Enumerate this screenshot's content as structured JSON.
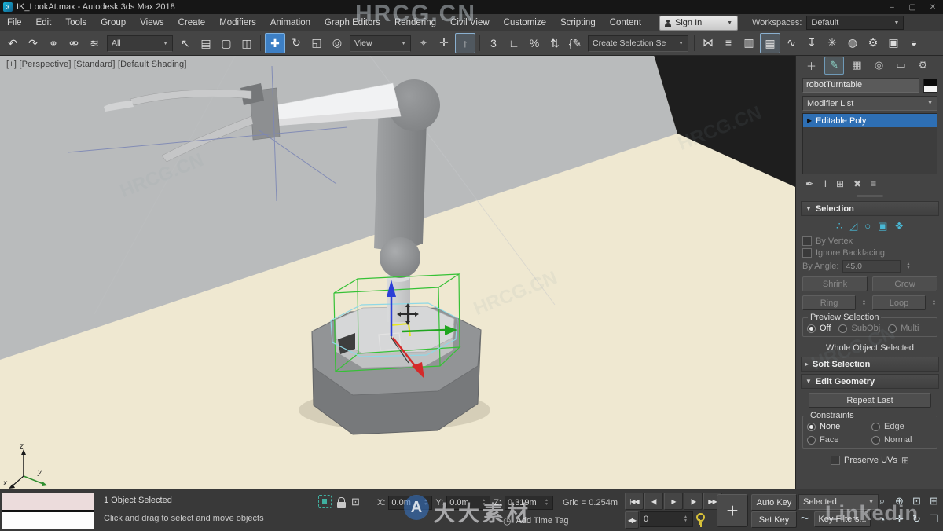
{
  "window": {
    "title": "IK_LookAt.max - Autodesk 3ds Max 2018",
    "logo": "3",
    "controls": [
      {
        "name": "minimize-button",
        "glyph": "–"
      },
      {
        "name": "maximize-button",
        "glyph": "▢"
      },
      {
        "name": "close-button",
        "glyph": "✕"
      }
    ]
  },
  "menu": {
    "items": [
      {
        "name": "menu-file",
        "label": "File"
      },
      {
        "name": "menu-edit",
        "label": "Edit"
      },
      {
        "name": "menu-tools",
        "label": "Tools"
      },
      {
        "name": "menu-group",
        "label": "Group"
      },
      {
        "name": "menu-views",
        "label": "Views"
      },
      {
        "name": "menu-create",
        "label": "Create"
      },
      {
        "name": "menu-modifiers",
        "label": "Modifiers"
      },
      {
        "name": "menu-animation",
        "label": "Animation"
      },
      {
        "name": "menu-graph-editors",
        "label": "Graph Editors"
      },
      {
        "name": "menu-rendering",
        "label": "Rendering"
      },
      {
        "name": "menu-civil-view",
        "label": "Civil View"
      },
      {
        "name": "menu-customize",
        "label": "Customize"
      },
      {
        "name": "menu-scripting",
        "label": "Scripting"
      },
      {
        "name": "menu-content",
        "label": "Content"
      }
    ],
    "sign_in": "Sign In",
    "workspaces_label": "Workspaces:",
    "workspace_value": "Default"
  },
  "toolbar": {
    "filter_value": "All",
    "coord_value": "View",
    "sets_value": "Create Selection Se",
    "group1": [
      {
        "name": "undo-button",
        "glyph": "↶"
      },
      {
        "name": "redo-button",
        "glyph": "↷"
      },
      {
        "name": "select-and-link-button",
        "glyph": "⚭"
      },
      {
        "name": "unlink-selection-button",
        "glyph": "⚮"
      },
      {
        "name": "bind-to-space-warp-button",
        "glyph": "≋"
      }
    ],
    "group2": [
      {
        "name": "select-object-button",
        "glyph": "↖"
      },
      {
        "name": "select-by-name-button",
        "glyph": "▤"
      },
      {
        "name": "rectangular-selection-region-button",
        "glyph": "▢"
      },
      {
        "name": "window-crossing-button",
        "glyph": "◫"
      }
    ],
    "group3": [
      {
        "name": "select-and-move-button",
        "glyph": "✚",
        "active": true
      },
      {
        "name": "select-and-rotate-button",
        "glyph": "↻"
      },
      {
        "name": "select-and-scale-button",
        "glyph": "◱"
      },
      {
        "name": "select-and-place-button",
        "glyph": "◎"
      }
    ],
    "group4": [
      {
        "name": "use-pivot-point-center-button",
        "glyph": "⌖"
      },
      {
        "name": "select-and-manipulate-button",
        "glyph": "✛"
      },
      {
        "name": "keyboard-shortcut-override-button",
        "glyph": "↑",
        "cls": "framed"
      }
    ],
    "group5": [
      {
        "name": "snap-toggle-3d-button",
        "glyph": "3"
      },
      {
        "name": "angle-snap-button",
        "glyph": "∟"
      },
      {
        "name": "percent-snap-button",
        "glyph": "%"
      },
      {
        "name": "spinner-snap-button",
        "glyph": "⇅"
      },
      {
        "name": "edit-named-selection-sets-button",
        "glyph": "{✎"
      }
    ],
    "group6": [
      {
        "name": "mirror-button",
        "glyph": "⋈"
      },
      {
        "name": "align-button",
        "glyph": "≡"
      },
      {
        "name": "scene-explorer-button",
        "glyph": "▥"
      },
      {
        "name": "layer-explorer-button",
        "glyph": "▦",
        "cls": "framed"
      },
      {
        "name": "curve-editor-button",
        "glyph": "∿"
      },
      {
        "name": "dope-sheet-button",
        "glyph": "↧"
      },
      {
        "name": "schematic-view-button",
        "glyph": "✳"
      },
      {
        "name": "material-editor-button",
        "glyph": "◍"
      },
      {
        "name": "render-setup-button",
        "glyph": "⚙"
      },
      {
        "name": "rendered-frame-button",
        "glyph": "▣"
      },
      {
        "name": "render-button",
        "glyph": "◒"
      }
    ]
  },
  "viewport": {
    "label": "[+] [Perspective] [Standard] [Default Shading]",
    "axis_x": "x",
    "axis_y": "y",
    "axis_z": "z"
  },
  "command_panel": {
    "tabs": [
      {
        "name": "tab-create",
        "glyph": "＋"
      },
      {
        "name": "tab-modify",
        "glyph": "✎",
        "active": true
      },
      {
        "name": "tab-hierarchy",
        "glyph": "▦"
      },
      {
        "name": "tab-motion",
        "glyph": "◎"
      },
      {
        "name": "tab-display",
        "glyph": "▭"
      },
      {
        "name": "tab-utilities",
        "glyph": "⚙"
      }
    ],
    "object_name": "robotTurntable",
    "modifier_list_label": "Modifier List",
    "stack": [
      {
        "name": "stack-item-editable-poly",
        "label": "Editable Poly",
        "selected": true
      }
    ],
    "stack_tools": [
      {
        "name": "pin-stack-button",
        "glyph": "✒"
      },
      {
        "name": "show-end-result-button",
        "glyph": "‖"
      },
      {
        "name": "make-unique-button",
        "glyph": "⊞"
      },
      {
        "name": "remove-modifier-button",
        "glyph": "✖"
      },
      {
        "name": "configure-modifier-sets-button",
        "glyph": "≡"
      }
    ],
    "selection": {
      "title": "Selection",
      "subobjects": [
        {
          "name": "vertex-subobject-button",
          "glyph": "∴"
        },
        {
          "name": "edge-subobject-button",
          "glyph": "◿"
        },
        {
          "name": "border-subobject-button",
          "glyph": "○"
        },
        {
          "name": "polygon-subobject-button",
          "glyph": "▣"
        },
        {
          "name": "element-subobject-button",
          "glyph": "❖"
        }
      ],
      "by_vertex": "By Vertex",
      "ignore_backfacing": "Ignore Backfacing",
      "by_angle": "By Angle:",
      "by_angle_value": "45.0",
      "shrink": "Shrink",
      "grow": "Grow",
      "ring": "Ring",
      "loop": "Loop",
      "preview_title": "Preview Selection",
      "preview_options": [
        {
          "name": "preview-off-radio",
          "label": "Off",
          "selected": true
        },
        {
          "name": "preview-subobj-radio",
          "label": "SubObj",
          "cls": "dis"
        },
        {
          "name": "preview-multi-radio",
          "label": "Multi",
          "cls": "dis"
        }
      ],
      "status": "Whole Object Selected"
    },
    "soft_selection_title": "Soft Selection",
    "edit_geometry": {
      "title": "Edit Geometry",
      "repeat_last": "Repeat Last",
      "constraints_title": "Constraints",
      "constraint_options": [
        {
          "name": "constraint-none-radio",
          "label": "None",
          "selected": true
        },
        {
          "name": "constraint-edge-radio",
          "label": "Edge"
        },
        {
          "name": "constraint-face-radio",
          "label": "Face"
        },
        {
          "name": "constraint-normal-radio",
          "label": "Normal"
        }
      ],
      "preserve_uvs": "Preserve UVs"
    }
  },
  "status_bar": {
    "status": "1 Object Selected",
    "prompt": "Click and drag to select and move objects",
    "x_label": "X:",
    "x_value": "0.0m",
    "y_label": "Y:",
    "y_value": "0.0m",
    "z_label": "Z:",
    "z_value": "0.319m",
    "grid": "Grid = 0.254m",
    "add_time_tag": "Add Time Tag",
    "add_time_tag_icon": "◷",
    "frame_value": "0",
    "key_mode_glyph": "◀▶",
    "playback": [
      {
        "name": "go-to-start-button",
        "glyph": "|◀◀"
      },
      {
        "name": "previous-frame-button",
        "glyph": "◀|"
      },
      {
        "name": "play-button",
        "glyph": "▶"
      },
      {
        "name": "next-frame-button",
        "glyph": "|▶"
      },
      {
        "name": "go-to-end-button",
        "glyph": "▶▶|"
      }
    ],
    "set_keys_glyph": "+",
    "auto_key": "Auto Key",
    "set_key": "Set Key",
    "selected_dropdown": "Selected",
    "tangent_glyph": "〜",
    "key_filters": "Key Filters...",
    "nav": [
      {
        "name": "zoom-button",
        "glyph": "⌕"
      },
      {
        "name": "zoom-all-button",
        "glyph": "⊕"
      },
      {
        "name": "zoom-extents-button",
        "glyph": "⊡"
      },
      {
        "name": "zoom-extents-all-button",
        "glyph": "⊞"
      },
      {
        "name": "field-of-view-button",
        "glyph": "◔"
      },
      {
        "name": "pan-button",
        "glyph": "✛"
      },
      {
        "name": "orbit-button",
        "glyph": "↻"
      },
      {
        "name": "maximize-viewport-button",
        "glyph": "❒"
      }
    ]
  },
  "watermarks": {
    "top": "HRCG.CN",
    "tiled": "HRCG.CN",
    "bottom_logo": "A",
    "bottom_center": "大大素材",
    "bottom_right": "Linkedin"
  }
}
